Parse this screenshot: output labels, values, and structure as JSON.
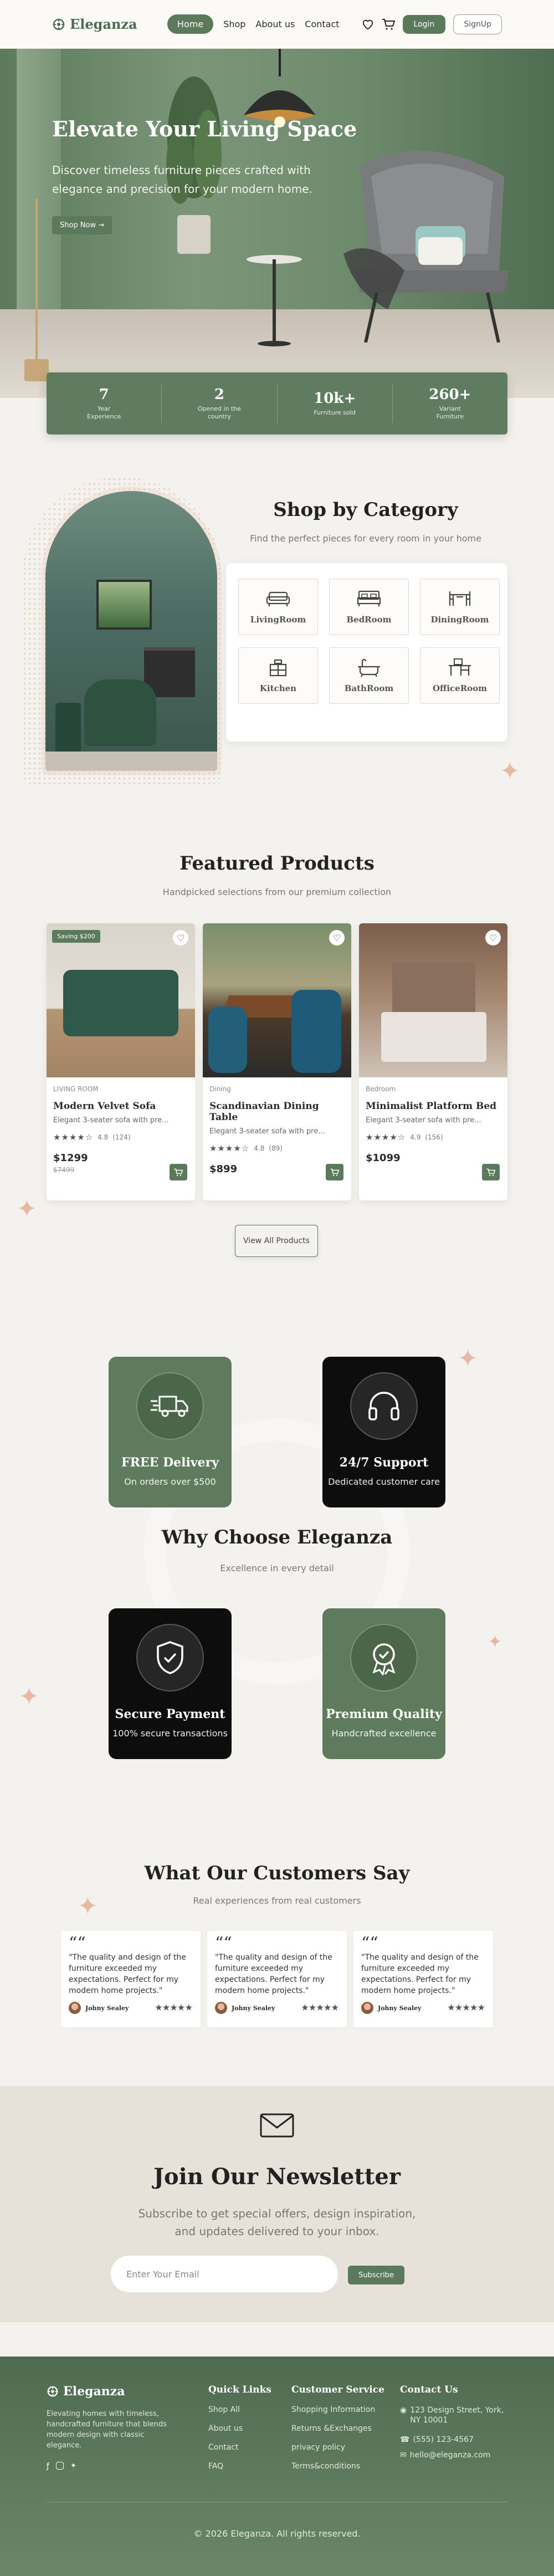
{
  "nav": {
    "brand": "Eleganza",
    "links": [
      "Home",
      "Shop",
      "About us",
      "Contact"
    ],
    "login": "Login",
    "signup": "SignUp"
  },
  "hero": {
    "title": "Elevate Your Living Space",
    "subtitle": "Discover timeless furniture pieces crafted with elegance and precision for your modern home.",
    "cta": "Shop Now"
  },
  "stats": [
    {
      "num": "7",
      "label": "Year Experience"
    },
    {
      "num": "2",
      "label": "Opened in the country"
    },
    {
      "num": "10k+",
      "label": "Furniture sold"
    },
    {
      "num": "260+",
      "label": "Variant Furniture"
    }
  ],
  "categories": {
    "title": "Shop by Category",
    "subtitle": "Find the perfect pieces for every room in your home",
    "items": [
      "LivingRoom",
      "BedRoom",
      "DiningRoom",
      "Kitchen",
      "BathRoom",
      "OfficeRoom"
    ]
  },
  "featured": {
    "title": "Featured Products",
    "subtitle": "Handpicked selections from our premium collection",
    "products": [
      {
        "badge": "Saving $200",
        "category": "LIVING ROOM",
        "name": "Modern Velvet Sofa",
        "desc": "Elegant 3-seater sofa with pre...",
        "rating": "4.8",
        "reviews": "(124)",
        "price": "$1299",
        "old": "$7499"
      },
      {
        "badge": "",
        "category": "Dining",
        "name": "Scandinavian Dining Table",
        "desc": "Elegant 3-seater sofa with pre...",
        "rating": "4.8",
        "reviews": "(89)",
        "price": "$899",
        "old": ""
      },
      {
        "badge": "",
        "category": "Bedroom",
        "name": "Minimalist Platform Bed",
        "desc": "Elegant 3-seater sofa with pre...",
        "rating": "4.9",
        "reviews": "(156)",
        "price": "$1099",
        "old": ""
      }
    ],
    "view_all": "View All Products"
  },
  "why": {
    "title": "Why Choose Eleganza",
    "subtitle": "Excellence in every detail",
    "features": [
      {
        "title": "FREE Delivery",
        "sub": "On orders over $500",
        "icon": "truck-icon"
      },
      {
        "title": "24/7 Support",
        "sub": "Dedicated customer care",
        "icon": "headphones-icon"
      },
      {
        "title": "Secure Payment",
        "sub": "100% secure transactions",
        "icon": "shield-check-icon"
      },
      {
        "title": "Premium Quality",
        "sub": "Handcrafted excellence",
        "icon": "award-badge-icon"
      }
    ]
  },
  "testimonials": {
    "title": "What Our Customers Say",
    "subtitle": "Real experiences from real customers",
    "items": [
      {
        "text": "\"The quality and design of the furniture exceeded my expectations. Perfect for my modern home projects.\"",
        "name": "Johny Sealey"
      },
      {
        "text": "\"The quality and design of the furniture exceeded my expectations. Perfect for my modern home projects.\"",
        "name": "Johny Sealey"
      },
      {
        "text": "\"The quality and design of the furniture exceeded my expectations. Perfect for my modern home projects.\"",
        "name": "Johny Sealey"
      }
    ]
  },
  "newsletter": {
    "title": "Join Our Newsletter",
    "subtitle": "Subscribe to get special offers, design inspiration, and updates delivered to your inbox.",
    "placeholder": "Enter Your Email",
    "button": "Subscribe"
  },
  "footer": {
    "brand": "Eleganza",
    "about": "Elevating homes with timeless, handcrafted furniture that blends modern design with classic elegance.",
    "quick_links_title": "Quick Links",
    "quick_links": [
      "Shop All",
      "About us",
      "Contact",
      "FAQ"
    ],
    "service_title": "Customer Service",
    "service_links": [
      "Shopping Information",
      "Returns &Exchanges",
      "privacy policy",
      "Terms&conditions"
    ],
    "contact_title": "Contact Us",
    "address": "123 Design Street, York, NY 10001",
    "phone": "(555) 123-4567",
    "email": "hello@eleganza.com",
    "copyright": "© 2026 Eleganza. All rights reserved."
  },
  "colors": {
    "accent": "#5b7a5c",
    "dark": "#0d0d0d",
    "bg": "#f4f2ee"
  }
}
